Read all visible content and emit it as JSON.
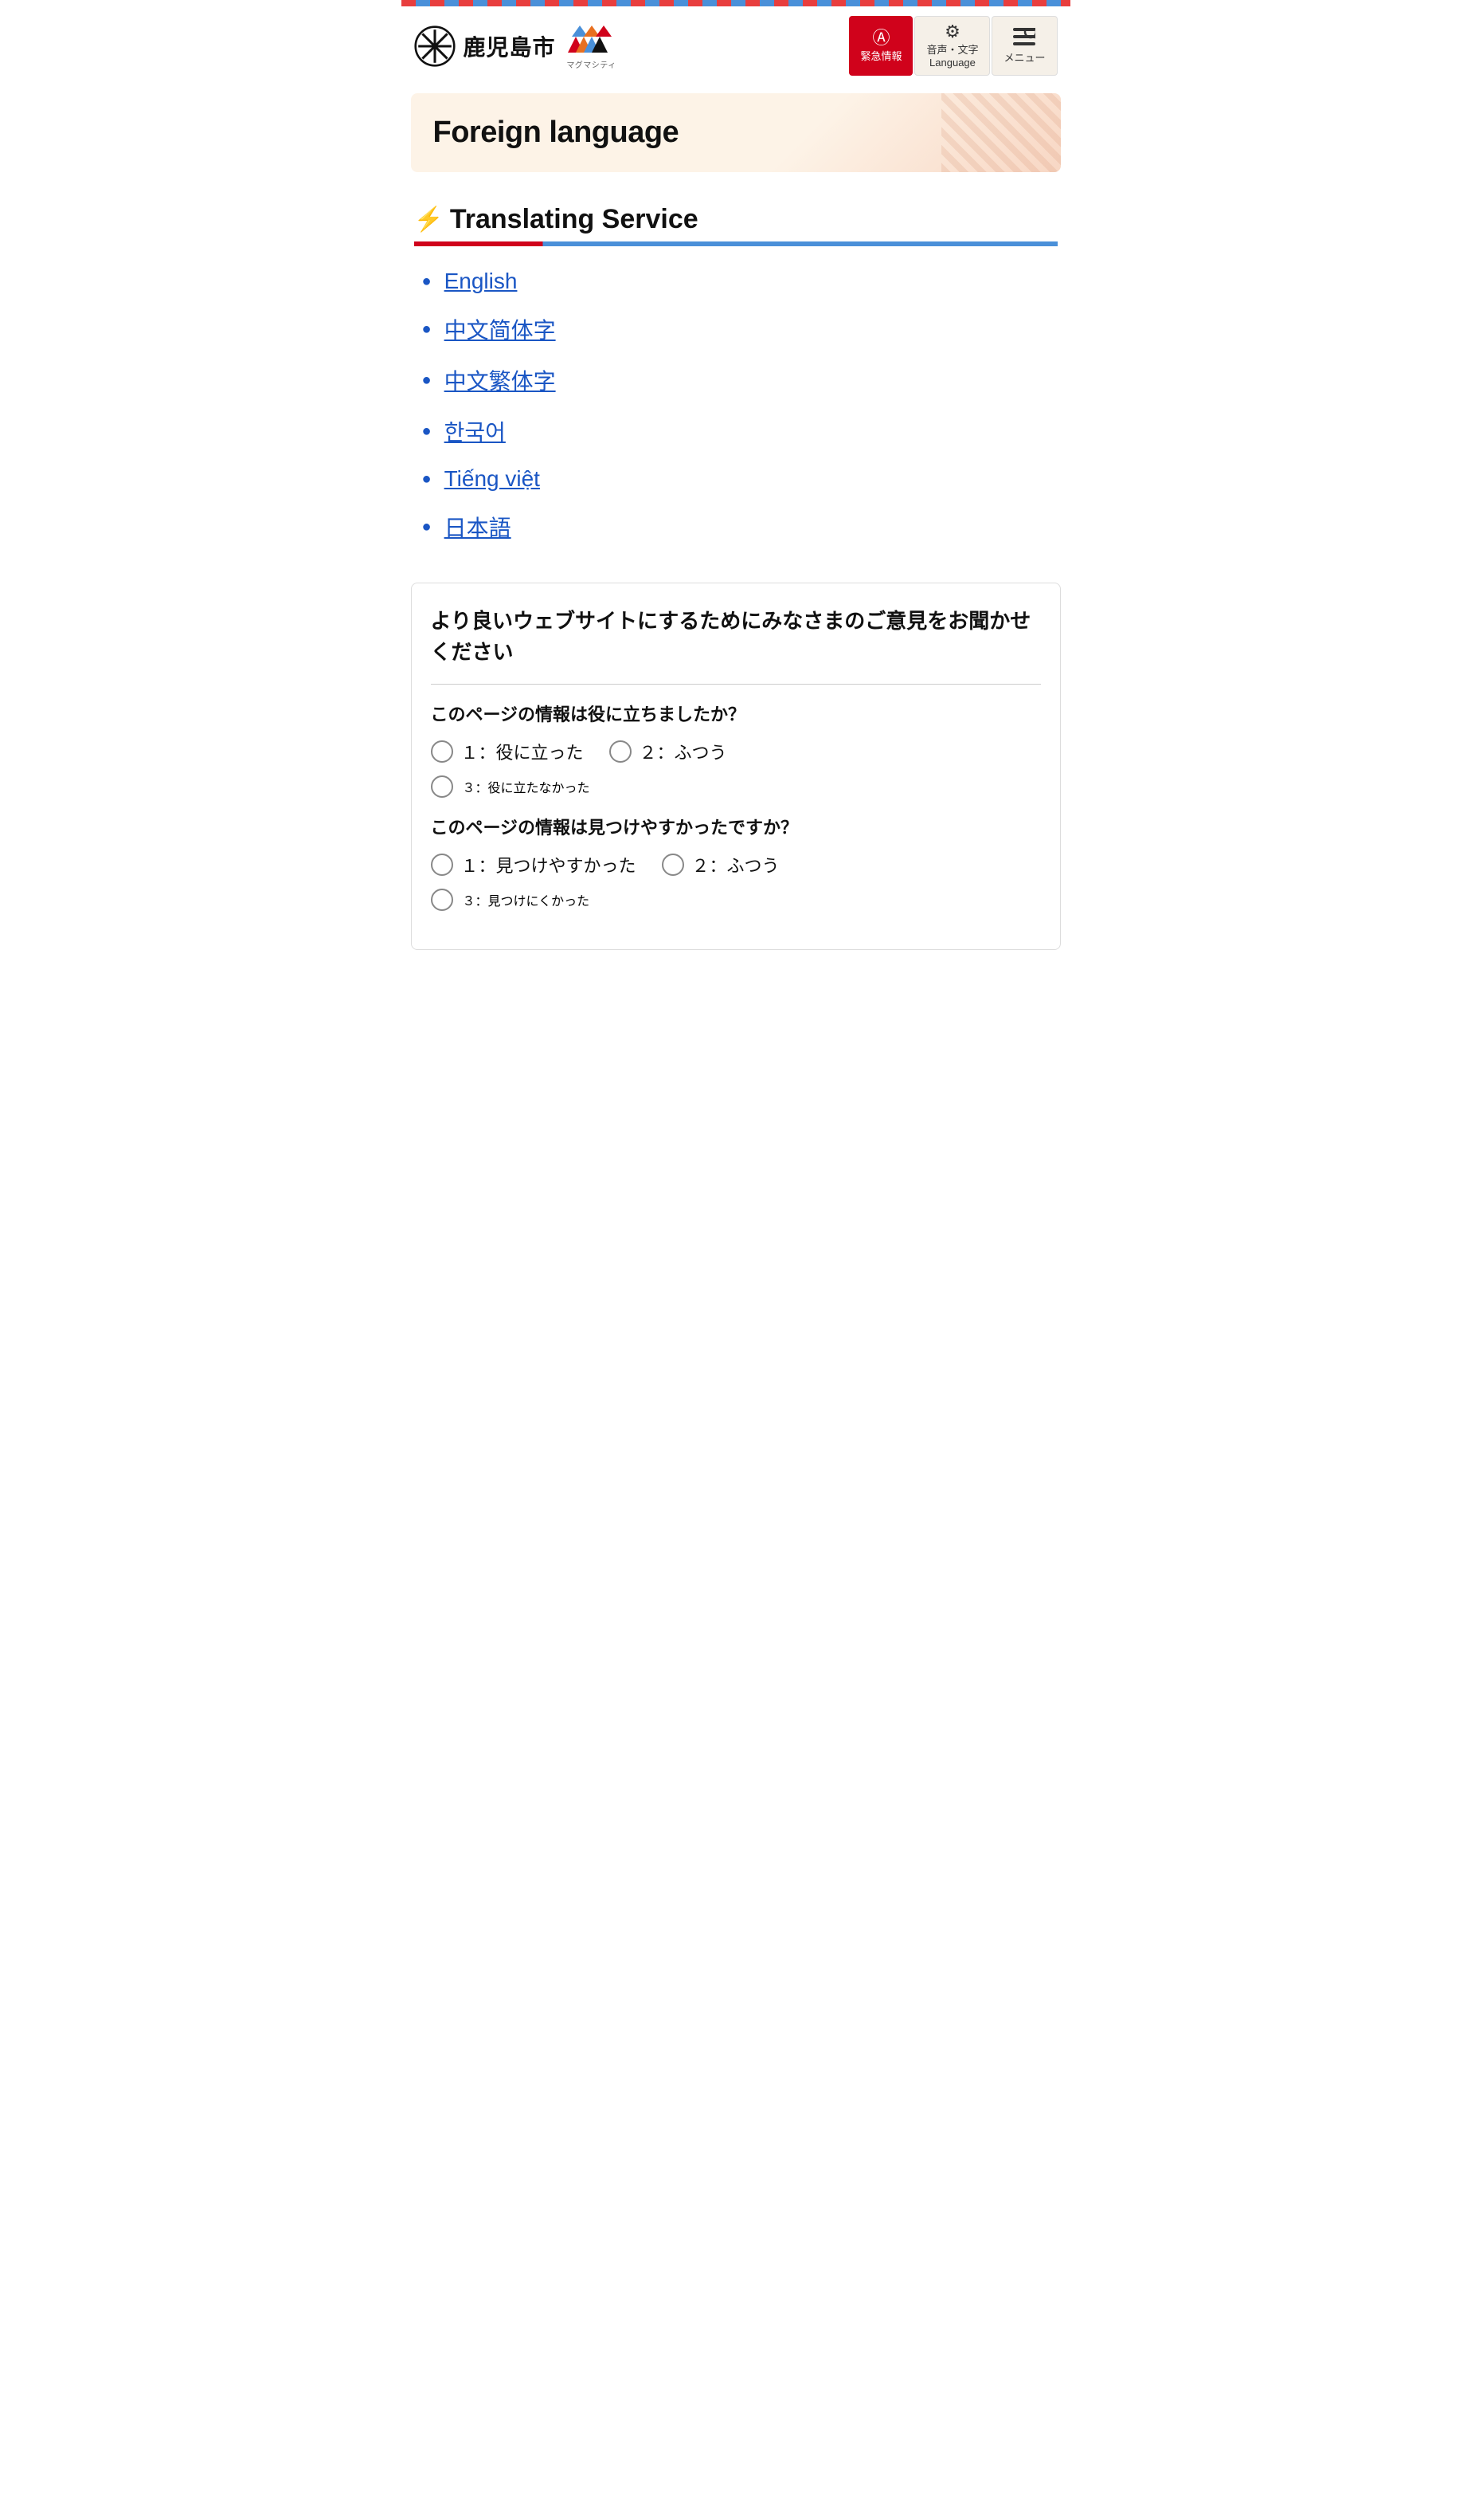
{
  "topBorder": {},
  "header": {
    "logoText": "鹿児島市",
    "logoSub": "マグマシティ",
    "logoSubSmall": "鹿児島市",
    "buttons": {
      "emergency": {
        "label": "緊急情報",
        "icon": "!"
      },
      "language": {
        "label": "音声・文字\nLanguage",
        "icon": "⚙"
      },
      "menu": {
        "label": "メニュー",
        "icon": "☰"
      }
    }
  },
  "hero": {
    "title": "Foreign language"
  },
  "translatingService": {
    "sectionTitle": "Translating Service",
    "languages": [
      {
        "label": "English",
        "href": "#"
      },
      {
        "label": "中文简体字",
        "href": "#"
      },
      {
        "label": "中文繁体字",
        "href": "#"
      },
      {
        "label": "한국어",
        "href": "#"
      },
      {
        "label": "Tiếng việt",
        "href": "#"
      },
      {
        "label": "日本語",
        "href": "#"
      }
    ]
  },
  "feedback": {
    "title": "より良いウェブサイトにするためにみなさまのご意見をお聞かせください",
    "questions": [
      {
        "text": "このページの情報は役に立ちましたか？",
        "options": [
          [
            {
              "label": "１：役に立った"
            },
            {
              "label": "２：ふつう"
            }
          ],
          [
            {
              "label": "３：役に立たなかった"
            }
          ]
        ]
      },
      {
        "text": "このページの情報は見つけやすかったですか？",
        "options": [
          [
            {
              "label": "１：見つけやすかった"
            },
            {
              "label": "２：ふつう"
            }
          ],
          [
            {
              "label": "３：見つけにくかった"
            }
          ]
        ]
      }
    ]
  }
}
